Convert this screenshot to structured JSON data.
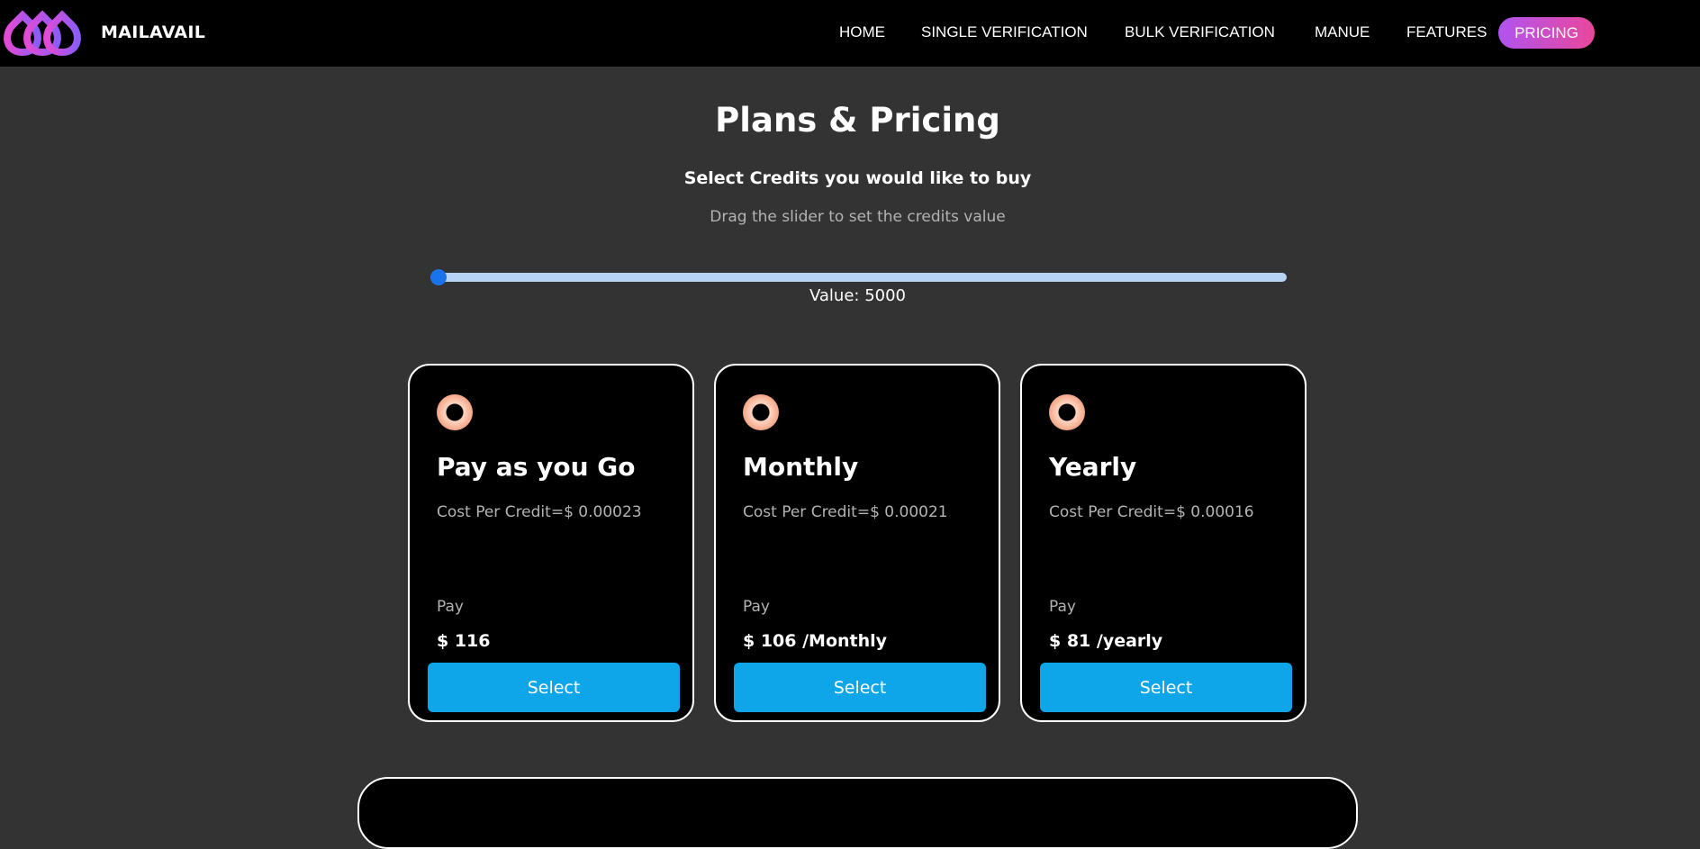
{
  "nav": {
    "brand": "MAILAVAIL",
    "links": [
      "HOME",
      "SINGLE VERIFICATION",
      "BULK VERIFICATION",
      "MANUE",
      "FEATURES"
    ],
    "active": "PRICING"
  },
  "header": {
    "title": "Plans & Pricing",
    "subtitle": "Select Credits you would like to buy",
    "hint": "Drag the slider to set the credits value"
  },
  "slider": {
    "value_text": "Value: 5000",
    "position_fraction": 0
  },
  "plans": [
    {
      "name": "Pay as you Go",
      "cost": "Cost Per Credit=$ 0.00023",
      "pay_label": "Pay",
      "price": "$ 116",
      "button": "Select"
    },
    {
      "name": "Monthly",
      "cost": "Cost Per Credit=$ 0.00021",
      "pay_label": "Pay",
      "price": "$ 106 /Monthly",
      "button": "Select"
    },
    {
      "name": "Yearly",
      "cost": "Cost Per Credit=$ 0.00016",
      "pay_label": "Pay",
      "price": "$ 81 /yearly",
      "button": "Select"
    }
  ],
  "colors": {
    "background": "#333333",
    "nav_background": "#000000",
    "accent_button": "#0ea5e9",
    "pill_gradient_start": "#b054f0",
    "pill_gradient_end": "#e9489b",
    "slider_thumb": "#1a73e8"
  },
  "icons": {
    "logo": "interlocked-rings-logo",
    "plan_icon": "ring-icon"
  }
}
